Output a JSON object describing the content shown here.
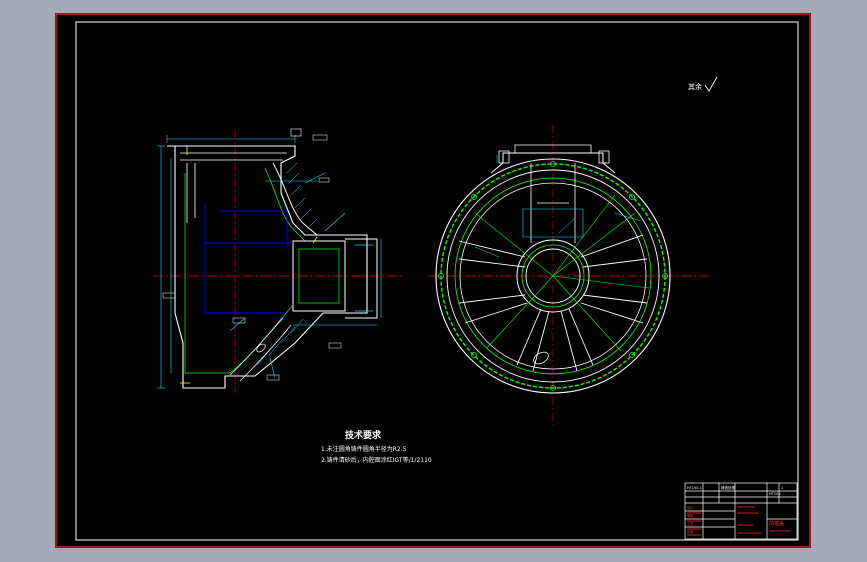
{
  "drawing": {
    "background_color": "#000000",
    "frame_color": "#ffffff",
    "outline_color": "#ff2a2a",
    "line_color_main": "#ffffff",
    "line_color_dim": "#00e5ff",
    "line_color_hidden": "#0000ff",
    "line_color_secondary": "#00ff00",
    "line_color_center": "#ff0000",
    "line_color_accent": "#ffff00",
    "roughness_note": "其余",
    "tech_requirements": {
      "title": "技术要求",
      "line1": "1.未注圆角铸件圆角半径为R2.5",
      "line2": "2.铸件清砂后，内腔面涂红IGT等/1/2110"
    },
    "title_block": {
      "cells_top": [
        "HT150-1",
        "铸造处理",
        "1"
      ],
      "code": "HT200",
      "part_name": "前端盖",
      "labels": [
        "设计",
        "审核",
        "工艺",
        "批准"
      ]
    }
  }
}
